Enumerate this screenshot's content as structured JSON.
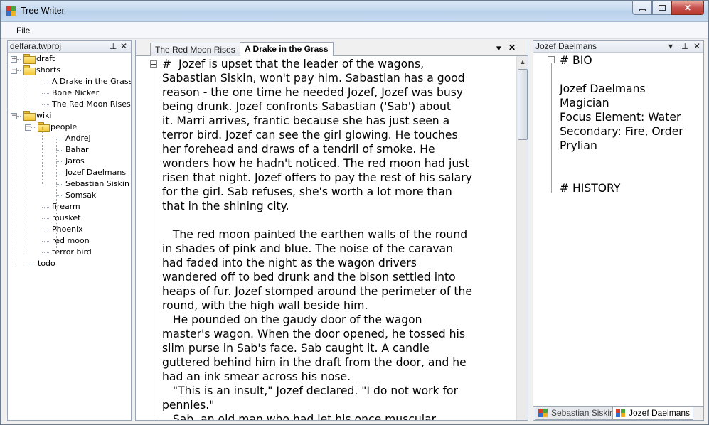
{
  "window": {
    "title": "Tree Writer",
    "accent": "#b9d1ea"
  },
  "menu": {
    "file": "File"
  },
  "project_pane": {
    "title": "delfara.twproj",
    "pin": "―",
    "close": "✕",
    "tree": [
      {
        "label": "draft",
        "folder": true,
        "expander": "+"
      },
      {
        "label": "shorts",
        "folder": true,
        "expander": "−"
      },
      {
        "label": "A Drake in the Grass"
      },
      {
        "label": "Bone Nicker"
      },
      {
        "label": "The Red Moon Rises"
      },
      {
        "label": "wiki",
        "folder": true,
        "expander": "−"
      },
      {
        "label": "people",
        "folder": true,
        "expander": "−"
      },
      {
        "label": "Andrej"
      },
      {
        "label": "Bahar"
      },
      {
        "label": "Jaros"
      },
      {
        "label": "Jozef Daelmans"
      },
      {
        "label": "Sebastian Siskin"
      },
      {
        "label": "Somsak"
      },
      {
        "label": "firearm"
      },
      {
        "label": "musket"
      },
      {
        "label": "Phoenix"
      },
      {
        "label": "red moon"
      },
      {
        "label": "terror bird"
      },
      {
        "label": "todo"
      }
    ]
  },
  "editor": {
    "tabs": [
      {
        "label": "The Red Moon Rises",
        "active": false
      },
      {
        "label": "A Drake in the Grass",
        "active": true
      }
    ],
    "dropdown": "▾",
    "close": "✕",
    "lines": [
      "#  Jozef is upset that the leader of the wagons,",
      "Sabastian Siskin, won't pay him. Sabastian has a good",
      "reason - the one time he needed Jozef, Jozef was busy",
      "being drunk. Jozef confronts Sabastian ('Sab') about",
      "it. Marri arrives, frantic because she has just seen a",
      "terror bird. Jozef can see the girl glowing. He touches",
      "her forehead and draws of a tendril of smoke. He",
      "wonders how he hadn't noticed. The red moon had just",
      "risen that night. Jozef offers to pay the rest of his salary",
      "for the girl. Sab refuses, she's worth a lot more than",
      "that in the shining city.",
      "",
      "   The red moon painted the earthen walls of the round",
      "in shades of pink and blue. The noise of the caravan",
      "had faded into the night as the wagon drivers",
      "wandered off to bed drunk and the bison settled into",
      "heaps of fur. Jozef stomped around the perimeter of the",
      "round, with the high wall beside him.",
      "   He pounded on the gaudy door of the wagon",
      "master's wagon. When the door opened, he tossed his",
      "slim purse in Sab's face. Sab caught it. A candle",
      "guttered behind him in the draft from the door, and he",
      "had an ink smear across his nose.",
      "   \"This is an insult,\" Jozef declared. \"I do not work for",
      "pennies.\"",
      "   Sab, an old man who had let his once muscular"
    ]
  },
  "notes_pane": {
    "title": "Jozef Daelmans",
    "dropdown": "▾",
    "pin": "―",
    "close": "✕",
    "lines": [
      "# BIO",
      "",
      "Jozef Daelmans",
      "Magician",
      "Focus Element: Water",
      "Secondary: Fire, Order",
      "Prylian",
      "",
      "",
      "# HISTORY"
    ],
    "bottom_tabs": [
      {
        "label": "Sebastian Siskin",
        "active": false
      },
      {
        "label": "Jozef Daelmans",
        "active": true
      }
    ]
  }
}
